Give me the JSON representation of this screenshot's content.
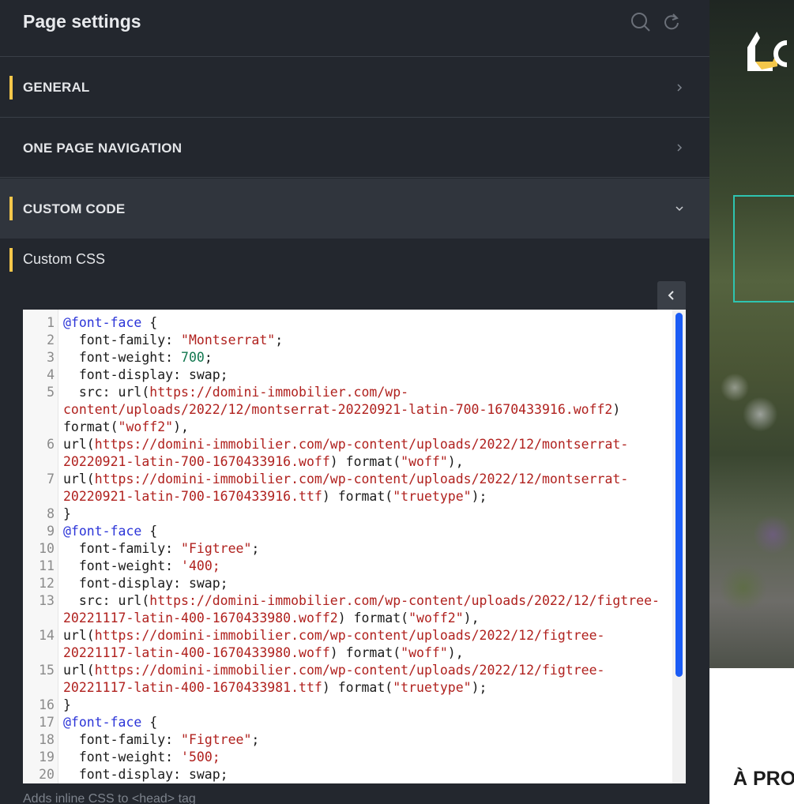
{
  "header": {
    "title": "Page settings",
    "icons": [
      "search-icon",
      "refresh-icon"
    ]
  },
  "sections": [
    {
      "label": "GENERAL",
      "state": "collapsed"
    },
    {
      "label": "ONE PAGE NAVIGATION",
      "state": "collapsed"
    },
    {
      "label": "CUSTOM CODE",
      "state": "expanded"
    }
  ],
  "custom_code": {
    "field_label": "Custom CSS",
    "hint": "Adds inline CSS to <head> tag",
    "line_numbers": [
      "1",
      "2",
      "3",
      "4",
      "5",
      "6",
      "7",
      "8",
      "9",
      "10",
      "11",
      "12",
      "13",
      "14",
      "15",
      "16",
      "17",
      "18",
      "19",
      "20"
    ]
  },
  "preview": {
    "heading": "À PRO"
  },
  "colors": {
    "accent": "#f4c74a",
    "panel_bg": "#23272e",
    "active_section_bg": "#30353d",
    "scrollbar": "#1b5cf5",
    "teal": "#2ec4b0"
  }
}
